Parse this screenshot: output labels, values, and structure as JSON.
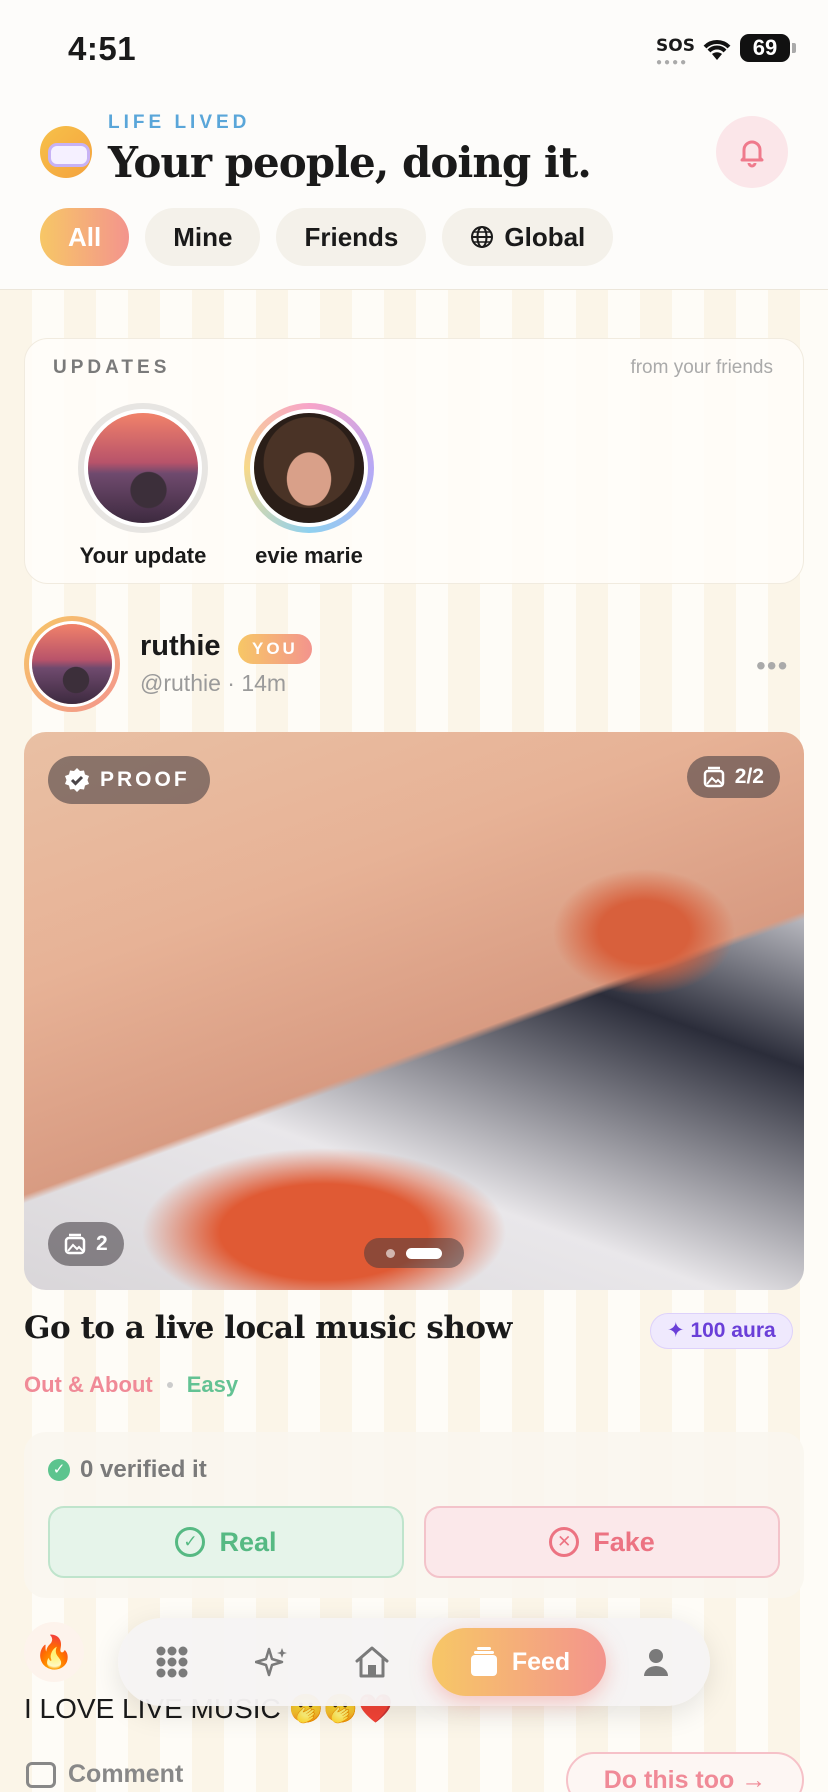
{
  "status_bar": {
    "time": "4:51",
    "sos": "SOS",
    "battery": "69"
  },
  "header": {
    "brand": "LIFE LIVED",
    "headline": "Your people, doing it.",
    "filters": [
      {
        "label": "All",
        "active": true
      },
      {
        "label": "Mine",
        "active": false
      },
      {
        "label": "Friends",
        "active": false
      },
      {
        "label": "Global",
        "active": false,
        "icon": "globe-icon"
      }
    ]
  },
  "updates": {
    "title": "UPDATES",
    "subtitle": "from your friends",
    "stories": [
      {
        "name": "Your update",
        "ring": "grey"
      },
      {
        "name": "evie marie",
        "ring": "rainbow"
      }
    ]
  },
  "post": {
    "name": "ruthie",
    "badge": "YOU",
    "meta": "@ruthie · 14m",
    "proof_label": "PROOF",
    "photo_counter": "2/2",
    "stack_count": "2",
    "task": "Go to a live local music show",
    "aura": "100 aura",
    "category": "Out & About",
    "difficulty": "Easy",
    "verified": "0 verified it",
    "real_label": "Real",
    "fake_label": "Fake",
    "caption": "I LOVE LIVE MUSIC 🫢🫢❤️",
    "comment_label": "Comment",
    "do_this_label": "Do this too →"
  },
  "nav": {
    "items": [
      "grid-icon",
      "sparkle-icon",
      "home-icon",
      "feed-icon",
      "profile-icon"
    ],
    "feed_label": "Feed"
  },
  "colors": {
    "accent_gradient_start": "#f7c766",
    "accent_gradient_end": "#f3948d",
    "brand_blue": "#5aa6d9",
    "aura_purple": "#6a3fd8",
    "real_green": "#56b983",
    "fake_red": "#ec7382"
  }
}
